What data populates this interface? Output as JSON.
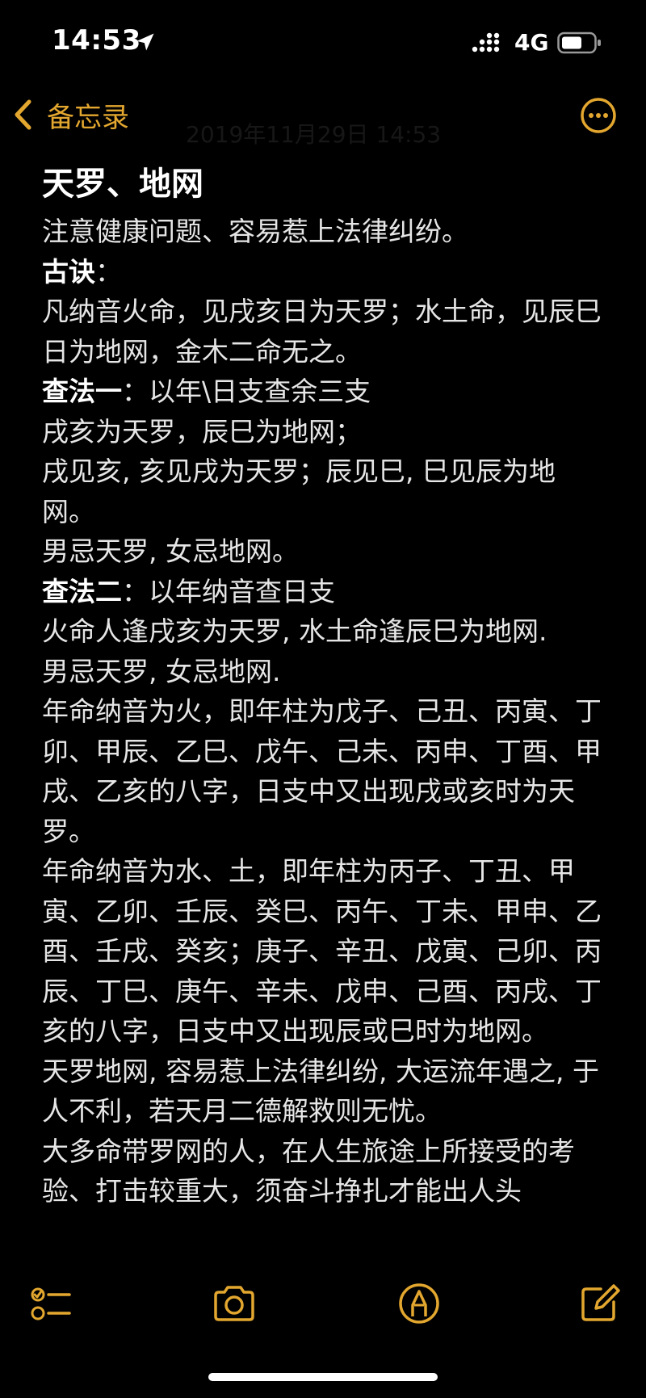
{
  "status_bar": {
    "time": "14:53",
    "network": "4G",
    "location_icon": "location-arrow-icon",
    "signal_icon": "cellular-signal-icon",
    "battery_icon": "battery-icon"
  },
  "nav": {
    "back_label": "备忘录",
    "back_icon": "chevron-left-icon",
    "more_icon": "ellipsis-circle-icon",
    "timestamp": "2019年11月29日 14:53",
    "accent_color": "#e3a72f"
  },
  "note": {
    "title": "天罗、地网",
    "lines": [
      {
        "bold": "",
        "text": "注意健康问题、容易惹上法律纠纷。"
      },
      {
        "bold": "古诀",
        "text": "："
      },
      {
        "bold": "",
        "text": "凡纳音火命，见戌亥日为天罗；水土命，见辰巳日为地网，金木二命无之。"
      },
      {
        "bold": "查法一",
        "text": "：以年\\日支查余三支"
      },
      {
        "bold": "",
        "text": "戌亥为天罗，辰巳为地网；"
      },
      {
        "bold": "",
        "text": "戌见亥, 亥见戌为天罗；辰见巳, 巳见辰为地网。"
      },
      {
        "bold": "",
        "text": "男忌天罗, 女忌地网。"
      },
      {
        "bold": "查法二",
        "text": "：以年纳音查日支"
      },
      {
        "bold": "",
        "text": "火命人逢戌亥为天罗, 水土命逢辰巳为地网."
      },
      {
        "bold": "",
        "text": "男忌天罗, 女忌地网."
      },
      {
        "bold": "",
        "text": "年命纳音为火，即年柱为戊子、己丑、丙寅、丁卯、甲辰、乙巳、戊午、己未、丙申、丁酉、甲戌、乙亥的八字，日支中又出现戌或亥时为天罗。"
      },
      {
        "bold": "",
        "text": "年命纳音为水、土，即年柱为丙子、丁丑、甲寅、乙卯、壬辰、癸巳、丙午、丁未、甲申、乙酉、壬戌、癸亥；庚子、辛丑、戊寅、己卯、丙辰、丁巳、庚午、辛未、戊申、己酉、丙戌、丁亥的八字，日支中又出现辰或巳时为地网。"
      },
      {
        "bold": "",
        "text": "天罗地网, 容易惹上法律纠纷, 大运流年遇之, 于人不利，若天月二德解救则无忧。"
      },
      {
        "bold": "",
        "text": "大多命带罗网的人，在人生旅途上所接受的考验、打击较重大，须奋斗挣扎才能出人头"
      }
    ]
  },
  "toolbar": {
    "checklist_icon": "checklist-icon",
    "camera_icon": "camera-icon",
    "markup_icon": "markup-pen-icon",
    "compose_icon": "compose-icon"
  }
}
